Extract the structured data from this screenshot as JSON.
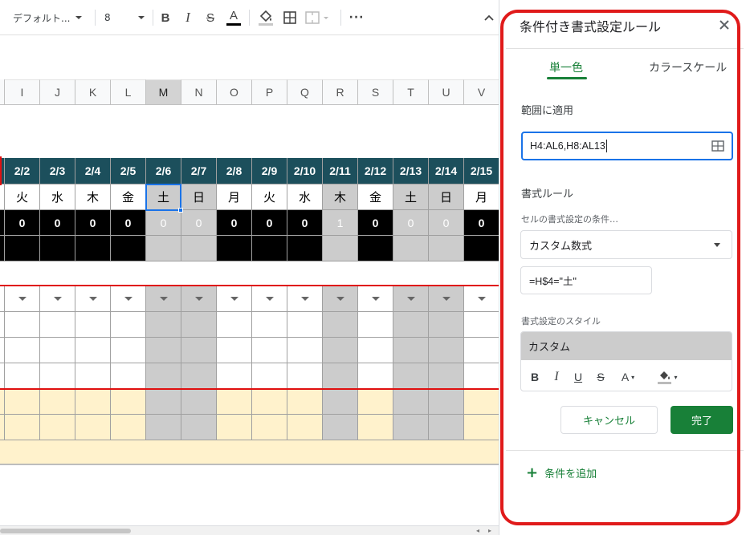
{
  "toolbar": {
    "font_name": "デフォルト...",
    "font_size": "8",
    "bold_icon": "bold-icon",
    "italic_icon": "italic-icon",
    "strike_icon": "strikethrough-icon",
    "text_color_icon": "text-color-icon",
    "fill_icon": "fill-color-icon",
    "borders_icon": "borders-icon",
    "merge_icon": "merge-cells-icon",
    "more_icon": "more-icon",
    "collapse_icon": "collapse-icon"
  },
  "sheet": {
    "columns": [
      "I",
      "J",
      "K",
      "L",
      "M",
      "N",
      "O",
      "P",
      "Q",
      "R",
      "S",
      "T",
      "U",
      "V"
    ],
    "selected_column": "M",
    "dates": [
      "2/2",
      "2/3",
      "2/4",
      "2/5",
      "2/6",
      "2/7",
      "2/8",
      "2/9",
      "2/10",
      "2/11",
      "2/12",
      "2/13",
      "2/14",
      "2/15"
    ],
    "weekdays": [
      "火",
      "水",
      "木",
      "金",
      "土",
      "日",
      "月",
      "火",
      "水",
      "木",
      "金",
      "土",
      "日",
      "月"
    ],
    "counts": [
      "0",
      "0",
      "0",
      "0",
      "0",
      "0",
      "0",
      "0",
      "0",
      "1",
      "0",
      "0",
      "0",
      "0"
    ],
    "gray_columns": [
      4,
      5,
      9,
      11,
      12
    ]
  },
  "panel": {
    "title": "条件付き書式設定ルール",
    "close_icon": "close-icon",
    "tabs": [
      {
        "label": "単一色",
        "active": true
      },
      {
        "label": "カラースケール",
        "active": false
      }
    ],
    "apply_range_label": "範囲に適用",
    "apply_range_value": "H4:AL6,H8:AL13",
    "range_icon": "select-range-icon",
    "rules_label": "書式ルール",
    "condition_label": "セルの書式設定の条件…",
    "condition_value": "カスタム数式",
    "formula_value": "=H$4=\"土\"",
    "style_label": "書式設定のスタイル",
    "style_preview": "カスタム",
    "cancel_label": "キャンセル",
    "done_label": "完了",
    "add_rule_label": "条件を追加",
    "colors": {
      "accent_green": "#188038",
      "header_teal": "#1c4f5c",
      "highlight_red": "#e01a1a",
      "weekend_gray": "#cccccc",
      "cream": "#fff2cc"
    }
  }
}
